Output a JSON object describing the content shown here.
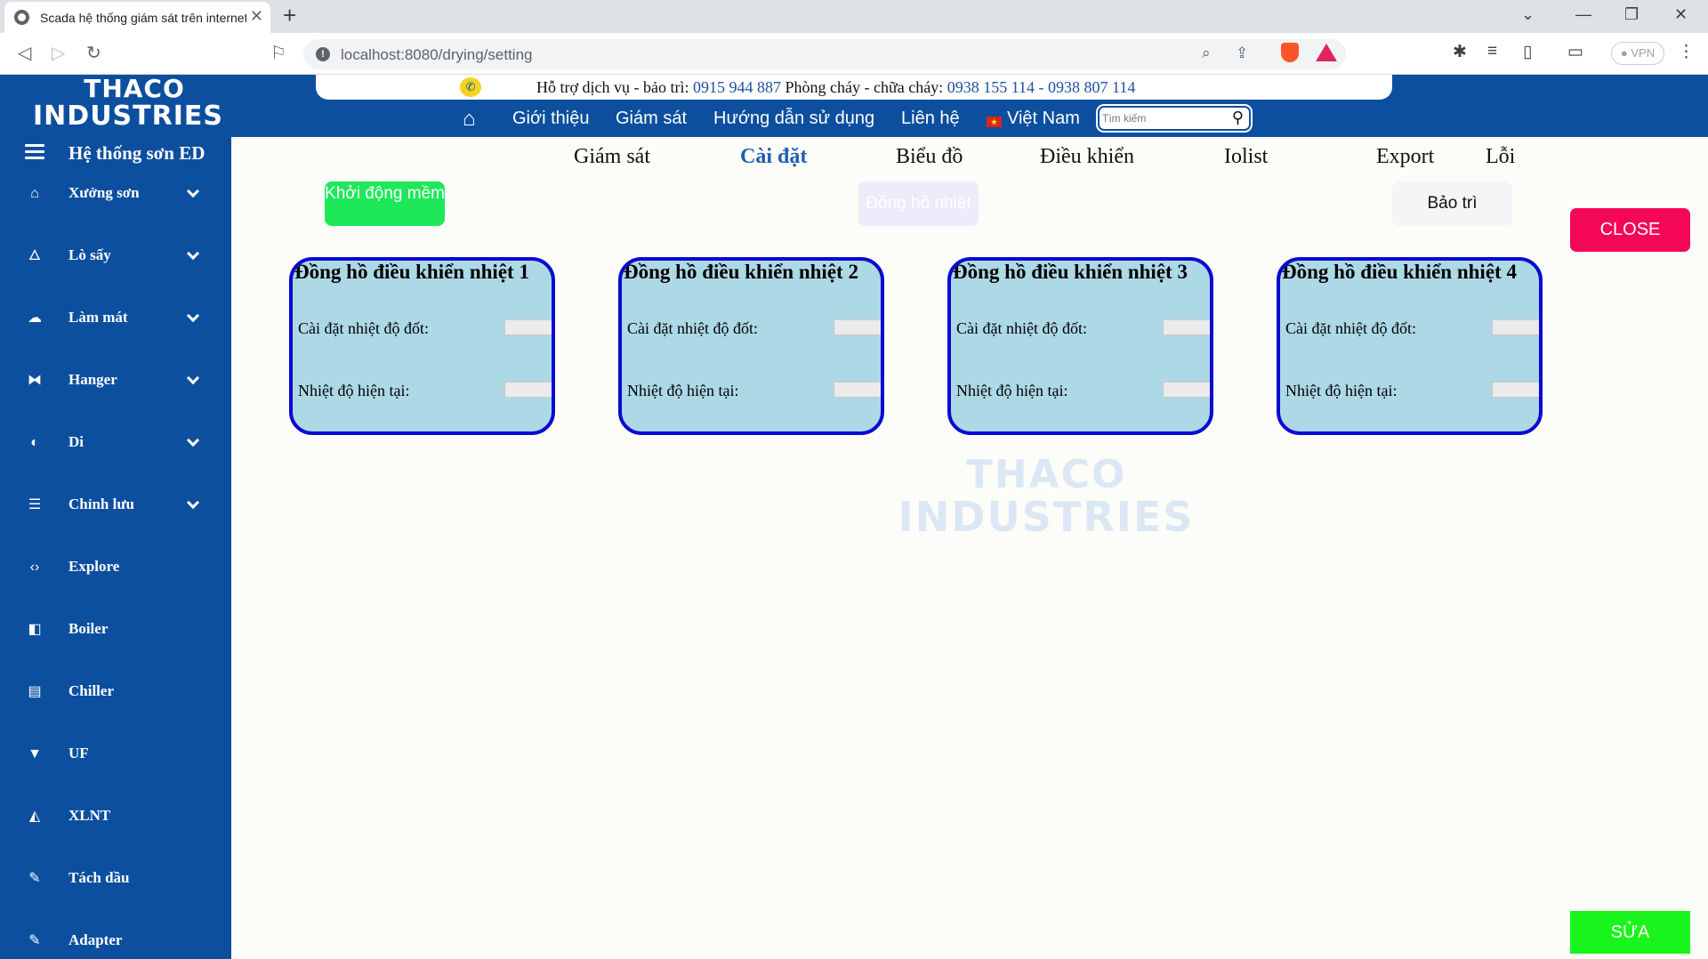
{
  "browser": {
    "tab_title": "Scada hệ thống giám sát trên internet",
    "url": "localhost:8080/drying/setting",
    "vpn_label": "VPN"
  },
  "header": {
    "logo_line1": "THACO",
    "logo_line2": "INDUSTRIES",
    "support_label": "Hỗ trợ dịch vụ - bảo trì:",
    "support_phone": "0915 944 887",
    "fire_label": "Phòng cháy - chữa cháy:",
    "fire_phone": "0938 155 114 - 0938 807 114",
    "nav": [
      "Giới thiệu",
      "Giám sát",
      "Hướng dẫn sử dụng",
      "Liên hệ",
      "Việt Nam"
    ],
    "search_placeholder": "Tìm kiếm"
  },
  "sidebar": {
    "title": "Hệ thống sơn ED",
    "items": [
      {
        "label": "Xưởng sơn",
        "icon": "home-icon",
        "expandable": true
      },
      {
        "label": "Lò sấy",
        "icon": "fire-icon",
        "expandable": true
      },
      {
        "label": "Làm mát",
        "icon": "cloud-icon",
        "expandable": true
      },
      {
        "label": "Hanger",
        "icon": "hanger-icon",
        "expandable": true
      },
      {
        "label": "Di",
        "icon": "droplet-icon",
        "expandable": true
      },
      {
        "label": "Chỉnh lưu",
        "icon": "database-icon",
        "expandable": true
      },
      {
        "label": "Explore",
        "icon": "code-icon",
        "expandable": false
      },
      {
        "label": "Boiler",
        "icon": "boiler-icon",
        "expandable": false
      },
      {
        "label": "Chiller",
        "icon": "chiller-icon",
        "expandable": false
      },
      {
        "label": "UF",
        "icon": "filter-icon",
        "expandable": false
      },
      {
        "label": "XLNT",
        "icon": "paint-bucket-icon",
        "expandable": false
      },
      {
        "label": "Tách dầu",
        "icon": "eraser-icon",
        "expandable": false
      },
      {
        "label": "Adapter",
        "icon": "eraser-icon",
        "expandable": false
      }
    ]
  },
  "subtabs": [
    "Giám sát",
    "Cài đặt",
    "Biểu đồ",
    "Điều khiển",
    "Iolist",
    "Export",
    "Lỗi"
  ],
  "active_subtab": "Cài đặt",
  "buttons": {
    "soft_start": "Khởi động mềm",
    "clock": "Đồng hồ nhiệt",
    "maintenance": "Bảo trì",
    "close": "CLOSE",
    "edit": "SỬA"
  },
  "cards": [
    {
      "title": "Đồng hồ điều khiển nhiệt 1",
      "setpoint_label": "Cài đặt nhiệt độ đốt:",
      "current_label": "Nhiệt độ hiện tại:",
      "setpoint_value": "",
      "current_value": ""
    },
    {
      "title": "Đồng hồ điều khiển nhiệt 2",
      "setpoint_label": "Cài đặt nhiệt độ đốt:",
      "current_label": "Nhiệt độ hiện tại:",
      "setpoint_value": "",
      "current_value": ""
    },
    {
      "title": "Đồng hồ điều khiển nhiệt 3",
      "setpoint_label": "Cài đặt nhiệt độ đốt:",
      "current_label": "Nhiệt độ hiện tại:",
      "setpoint_value": "",
      "current_value": ""
    },
    {
      "title": "Đồng hồ điều khiển nhiệt 4",
      "setpoint_label": "Cài đặt nhiệt độ đốt:",
      "current_label": "Nhiệt độ hiện tại:",
      "setpoint_value": "",
      "current_value": ""
    }
  ],
  "watermark": {
    "line1": "THACO",
    "line2": "INDUSTRIES"
  },
  "colors": {
    "brand_blue": "#0d4f9f",
    "card_bg": "#add8e6",
    "card_border": "#0a0ad2",
    "soft_start_green": "#1ee85a",
    "close_red": "#f50757",
    "edit_green": "#19f51c"
  }
}
